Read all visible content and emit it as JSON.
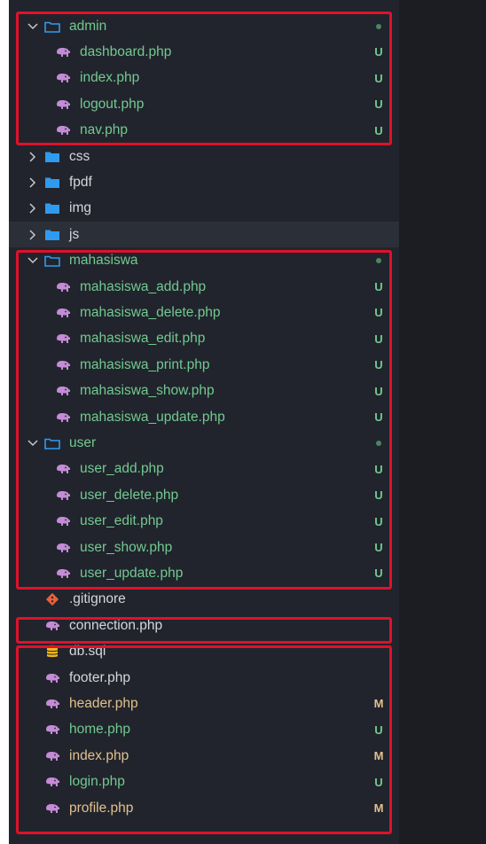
{
  "colors": {
    "untracked": "#73c991",
    "modified": "#e2c08d",
    "highlight": "#e0112b",
    "folder_icon": "#2f9bf0",
    "php_icon": "#c48bd6"
  },
  "tree": [
    {
      "label": "admin",
      "kind": "folder-open",
      "depth": 0,
      "status": "dot",
      "color": "green"
    },
    {
      "label": "dashboard.php",
      "kind": "php",
      "depth": 1,
      "status": "U",
      "color": "green"
    },
    {
      "label": "index.php",
      "kind": "php",
      "depth": 1,
      "status": "U",
      "color": "green"
    },
    {
      "label": "logout.php",
      "kind": "php",
      "depth": 1,
      "status": "U",
      "color": "green"
    },
    {
      "label": "nav.php",
      "kind": "php",
      "depth": 1,
      "status": "U",
      "color": "green"
    },
    {
      "label": "css",
      "kind": "folder-closed",
      "depth": 0,
      "status": "",
      "color": "normal"
    },
    {
      "label": "fpdf",
      "kind": "folder-closed",
      "depth": 0,
      "status": "",
      "color": "normal"
    },
    {
      "label": "img",
      "kind": "folder-closed",
      "depth": 0,
      "status": "",
      "color": "normal"
    },
    {
      "label": "js",
      "kind": "folder-closed",
      "depth": 0,
      "status": "",
      "color": "normal",
      "hover": true
    },
    {
      "label": "mahasiswa",
      "kind": "folder-open",
      "depth": 0,
      "status": "dot",
      "color": "green"
    },
    {
      "label": "mahasiswa_add.php",
      "kind": "php",
      "depth": 1,
      "status": "U",
      "color": "green"
    },
    {
      "label": "mahasiswa_delete.php",
      "kind": "php",
      "depth": 1,
      "status": "U",
      "color": "green"
    },
    {
      "label": "mahasiswa_edit.php",
      "kind": "php",
      "depth": 1,
      "status": "U",
      "color": "green"
    },
    {
      "label": "mahasiswa_print.php",
      "kind": "php",
      "depth": 1,
      "status": "U",
      "color": "green"
    },
    {
      "label": "mahasiswa_show.php",
      "kind": "php",
      "depth": 1,
      "status": "U",
      "color": "green"
    },
    {
      "label": "mahasiswa_update.php",
      "kind": "php",
      "depth": 1,
      "status": "U",
      "color": "green"
    },
    {
      "label": "user",
      "kind": "folder-open",
      "depth": 0,
      "status": "dot",
      "color": "green"
    },
    {
      "label": "user_add.php",
      "kind": "php",
      "depth": 1,
      "status": "U",
      "color": "green"
    },
    {
      "label": "user_delete.php",
      "kind": "php",
      "depth": 1,
      "status": "U",
      "color": "green"
    },
    {
      "label": "user_edit.php",
      "kind": "php",
      "depth": 1,
      "status": "U",
      "color": "green"
    },
    {
      "label": "user_show.php",
      "kind": "php",
      "depth": 1,
      "status": "U",
      "color": "green"
    },
    {
      "label": "user_update.php",
      "kind": "php",
      "depth": 1,
      "status": "U",
      "color": "green"
    },
    {
      "label": ".gitignore",
      "kind": "git",
      "depth": 1,
      "status": "",
      "color": "normal"
    },
    {
      "label": "connection.php",
      "kind": "php",
      "depth": 1,
      "status": "",
      "color": "normal"
    },
    {
      "label": "db.sql",
      "kind": "db",
      "depth": 1,
      "status": "",
      "color": "normal"
    },
    {
      "label": "footer.php",
      "kind": "php",
      "depth": 1,
      "status": "",
      "color": "normal"
    },
    {
      "label": "header.php",
      "kind": "php",
      "depth": 1,
      "status": "M",
      "color": "yellow"
    },
    {
      "label": "home.php",
      "kind": "php",
      "depth": 1,
      "status": "U",
      "color": "green"
    },
    {
      "label": "index.php",
      "kind": "php",
      "depth": 1,
      "status": "M",
      "color": "yellow"
    },
    {
      "label": "login.php",
      "kind": "php",
      "depth": 1,
      "status": "U",
      "color": "green"
    },
    {
      "label": "profile.php",
      "kind": "php",
      "depth": 1,
      "status": "M",
      "color": "yellow"
    }
  ]
}
